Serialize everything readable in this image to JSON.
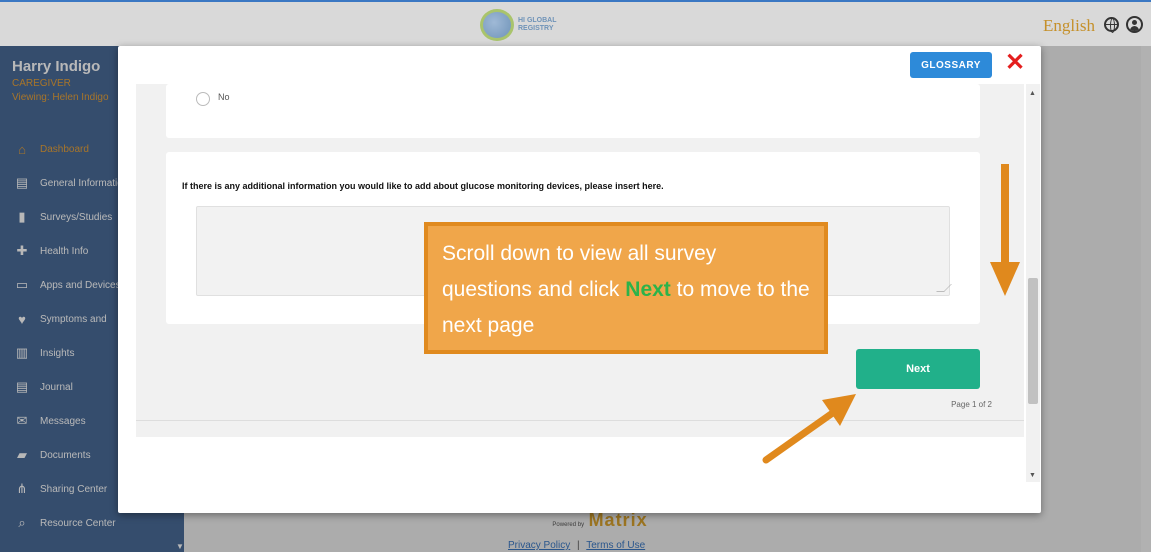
{
  "header": {
    "logo_text": "HI GLOBAL\nREGISTRY",
    "language": "English"
  },
  "sidebar": {
    "user_name": "Harry Indigo",
    "role": "CAREGIVER",
    "viewing": "Viewing: Helen Indigo",
    "items": [
      {
        "label": "Dashboard",
        "icon": "home-icon",
        "glyph": "⌂"
      },
      {
        "label": "General Information",
        "icon": "id-card-icon",
        "glyph": "▤"
      },
      {
        "label": "Surveys/Studies",
        "icon": "survey-icon",
        "glyph": "▮"
      },
      {
        "label": "Health Info",
        "icon": "plus-icon",
        "glyph": "✚"
      },
      {
        "label": "Apps and Devices",
        "icon": "laptop-icon",
        "glyph": "▭"
      },
      {
        "label": "Symptoms and",
        "icon": "heart-icon",
        "glyph": "♥"
      },
      {
        "label": "Insights",
        "icon": "chart-icon",
        "glyph": "▥"
      },
      {
        "label": "Journal",
        "icon": "journal-icon",
        "glyph": "▤"
      },
      {
        "label": "Messages",
        "icon": "envelope-icon",
        "glyph": "✉"
      },
      {
        "label": "Documents",
        "icon": "folder-icon",
        "glyph": "▰"
      },
      {
        "label": "Sharing Center",
        "icon": "share-icon",
        "glyph": "⋔"
      },
      {
        "label": "Resource Center",
        "icon": "resource-icon",
        "glyph": "⌕"
      }
    ]
  },
  "modal": {
    "glossary_label": "GLOSSARY",
    "close_label": "✕",
    "radio_label": "No",
    "question": "If there is any additional information you would like to add about glucose monitoring devices, please insert here.",
    "answer_value": "",
    "next_label": "Next",
    "page_indicator": "Page 1 of 2"
  },
  "callout": {
    "text_before": "Scroll down to view all survey questions and click ",
    "highlight": "Next",
    "text_after": " to move to the next page"
  },
  "footer": {
    "powered_by": "Powered by",
    "brand": "Matrix",
    "privacy": "Privacy Policy",
    "separator": "|",
    "terms": "Terms of Use"
  },
  "colors": {
    "accent_blue": "#2d8ad9",
    "next_green": "#21b08a",
    "callout_orange": "#f0a64a",
    "arrow_orange": "#e0891d",
    "close_red": "#e41e1e",
    "sidebar_bg": "#4a6b98",
    "active_orange": "#e8a23a"
  }
}
